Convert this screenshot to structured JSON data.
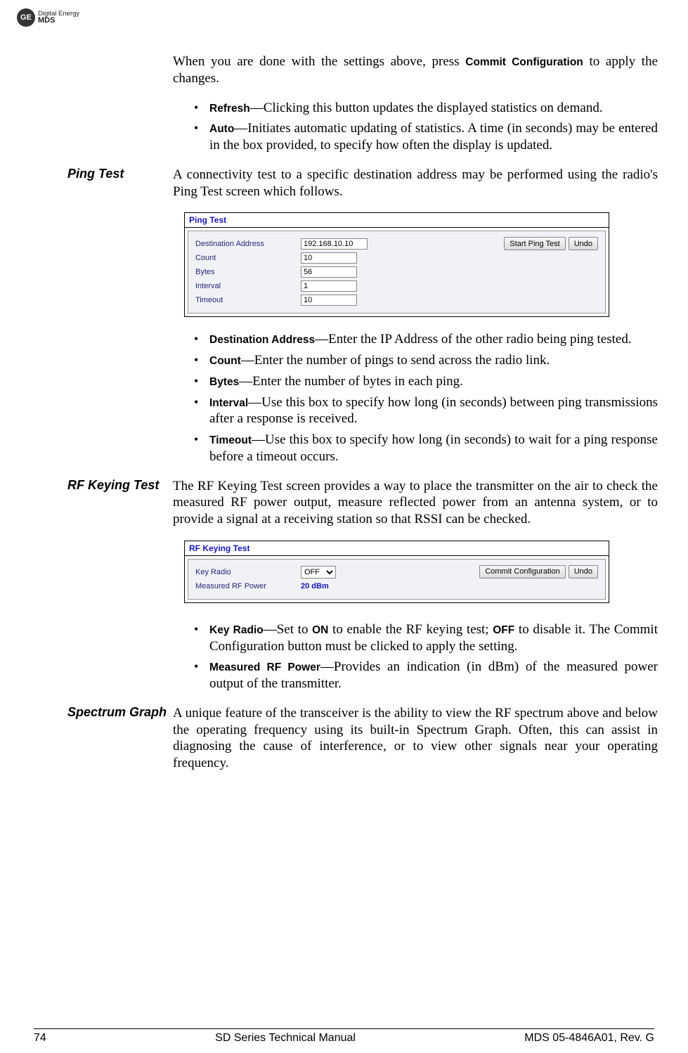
{
  "logo": {
    "brand_line1": "Digital Energy",
    "brand_line2": "MDS",
    "ge": "GE"
  },
  "intro": {
    "text_a": "When you are done with the settings above, press ",
    "term": "Commit Configuration",
    "text_b": " to apply the changes."
  },
  "param_list1": {
    "refresh": {
      "term": "Refresh",
      "desc": "—Clicking this button updates the displayed statistics on demand."
    },
    "auto": {
      "term": "Auto",
      "desc": "—Initiates automatic updating of statistics. A time (in seconds) may be entered in the box provided, to specify how often the display is updated."
    }
  },
  "ping": {
    "heading": "Ping Test",
    "intro": "A connectivity test to a specific destination address may be performed using the radio's Ping Test screen which follows.",
    "panel": {
      "title": "Ping Test",
      "btn_start": "Start Ping Test",
      "btn_undo": "Undo",
      "rows": {
        "dest": {
          "label": "Destination Address",
          "value": "192.168.10.10"
        },
        "count": {
          "label": "Count",
          "value": "10"
        },
        "bytes": {
          "label": "Bytes",
          "value": "56"
        },
        "interval": {
          "label": "Interval",
          "value": "1"
        },
        "timeout": {
          "label": "Timeout",
          "value": "10"
        }
      }
    },
    "bullets": {
      "dest": {
        "term": "Destination Address",
        "desc": "—Enter the IP Address of the other radio being ping tested."
      },
      "count": {
        "term": "Count",
        "desc": "—Enter the number of pings to send across the radio link."
      },
      "bytes": {
        "term": "Bytes",
        "desc": "—Enter the number of bytes in each ping."
      },
      "interval": {
        "term": "Interval",
        "desc": "—Use this box to specify how long (in seconds) between ping transmissions after a response is received."
      },
      "timeout": {
        "term": "Timeout",
        "desc": "—Use this box to specify how long (in seconds) to wait for a ping response before a timeout occurs."
      }
    }
  },
  "rfkey": {
    "heading": "RF Keying Test",
    "intro": "The RF Keying Test screen provides a way to place the transmitter on the air to check the measured RF power output, measure reflected power from an antenna system, or to provide a signal at a receiving station so that RSSI can be checked.",
    "panel": {
      "title": "RF Keying Test",
      "btn_commit": "Commit Configuration",
      "btn_undo": "Undo",
      "rows": {
        "key_radio": {
          "label": "Key Radio",
          "value": "OFF"
        },
        "measured": {
          "label": "Measured RF Power",
          "value": "20 dBm"
        }
      }
    },
    "bullets": {
      "key_radio": {
        "term": "Key Radio",
        "desc_a": "—Set to ",
        "on": "ON",
        "desc_b": " to enable the RF keying test; ",
        "off": "OFF",
        "desc_c": " to disable it. The Commit Configuration button must be clicked to apply the setting."
      },
      "measured": {
        "term": "Measured RF Power",
        "desc": "—Provides an indication (in dBm) of the measured power output of the transmitter."
      }
    }
  },
  "spectrum": {
    "heading": "Spectrum Graph",
    "intro": "A unique feature of the transceiver is the ability to view the RF spectrum above and below the operating frequency using its built-in Spectrum Graph. Often, this can assist in diagnosing the cause of interference, or to view other signals near your operating frequency."
  },
  "footer": {
    "page": "74",
    "center": "SD Series Technical Manual",
    "right": "MDS 05-4846A01, Rev. G"
  }
}
